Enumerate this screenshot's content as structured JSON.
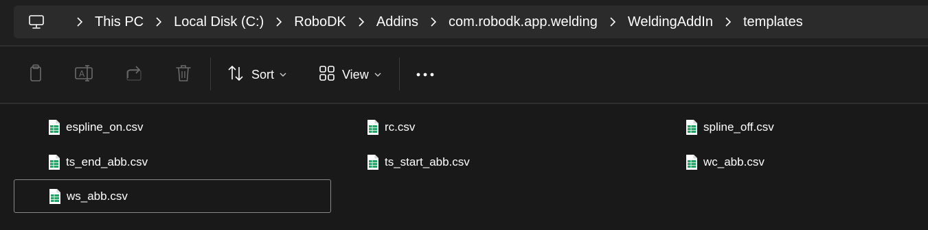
{
  "address_bar": {
    "icon": "monitor-icon",
    "crumbs": [
      "This PC",
      "Local Disk (C:)",
      "RoboDK",
      "Addins",
      "com.robodk.app.welding",
      "WeldingAddIn",
      "templates"
    ]
  },
  "toolbar": {
    "copy_icon": "copy-icon",
    "rename_icon": "rename-icon",
    "share_icon": "share-icon",
    "delete_icon": "trash-icon",
    "sort_label": "Sort",
    "view_label": "View",
    "more_icon": "more-icon"
  },
  "files": [
    {
      "name": "espline_on.csv",
      "icon": "spreadsheet-file-icon",
      "selected": false
    },
    {
      "name": "rc.csv",
      "icon": "spreadsheet-file-icon",
      "selected": false
    },
    {
      "name": "spline_off.csv",
      "icon": "spreadsheet-file-icon",
      "selected": false
    },
    {
      "name": "ts_end_abb.csv",
      "icon": "spreadsheet-file-icon",
      "selected": false
    },
    {
      "name": "ts_start_abb.csv",
      "icon": "spreadsheet-file-icon",
      "selected": false
    },
    {
      "name": "wc_abb.csv",
      "icon": "spreadsheet-file-icon",
      "selected": false
    },
    {
      "name": "ws_abb.csv",
      "icon": "spreadsheet-file-icon",
      "selected": true
    }
  ],
  "colors": {
    "background": "#1c1c1c",
    "address_bar": "#2b2b2b",
    "file_icon_green": "#21a366",
    "text": "#ffffff",
    "disabled_icon": "#6b6b6b"
  }
}
